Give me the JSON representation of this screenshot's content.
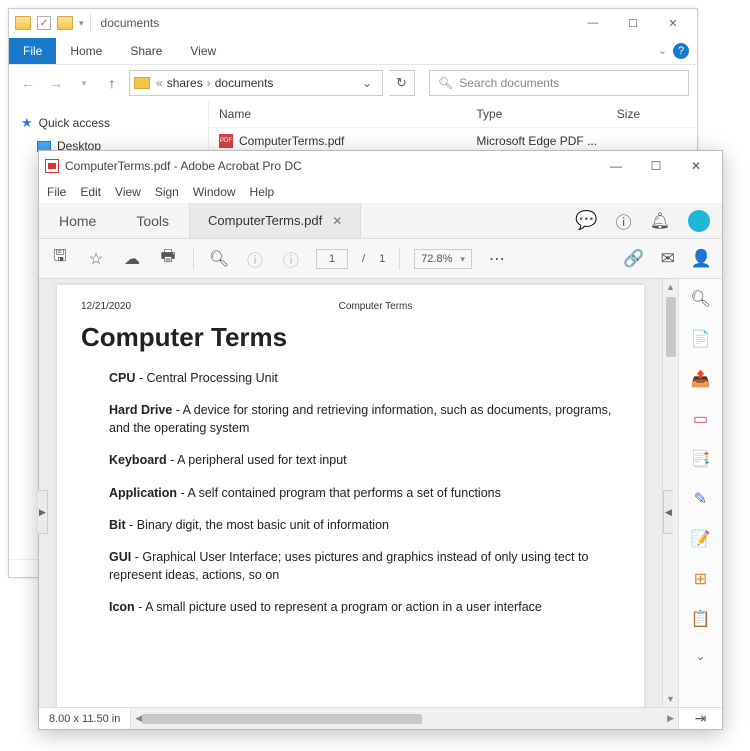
{
  "explorer": {
    "title": "documents",
    "ribbon": {
      "file": "File",
      "home": "Home",
      "share": "Share",
      "view": "View"
    },
    "breadcrumb": {
      "root_hint": "«",
      "items": [
        "shares",
        "documents"
      ]
    },
    "search_placeholder": "Search documents",
    "columns": {
      "name": "Name",
      "type": "Type",
      "size": "Size"
    },
    "tree": {
      "quick_access": "Quick access",
      "desktop": "Desktop"
    },
    "files": [
      {
        "name": "ComputerTerms.pdf",
        "type": "Microsoft Edge PDF ...",
        "size": ""
      }
    ]
  },
  "acrobat": {
    "title": "ComputerTerms.pdf - Adobe Acrobat Pro DC",
    "menu": {
      "file": "File",
      "edit": "Edit",
      "view": "View",
      "sign": "Sign",
      "window": "Window",
      "help": "Help"
    },
    "tabs": {
      "home": "Home",
      "tools": "Tools",
      "doc": "ComputerTerms.pdf"
    },
    "toolbar": {
      "page_current": "1",
      "page_total": "1",
      "page_sep": "/",
      "zoom": "72.8%"
    },
    "status": {
      "dims": "8.00 x 11.50 in"
    },
    "document": {
      "date": "12/21/2020",
      "header_center": "Computer Terms",
      "title": "Computer Terms",
      "terms": [
        {
          "name": "CPU",
          "def": " - Central Processing Unit"
        },
        {
          "name": "Hard Drive",
          "def": " - A device for storing and retrieving information, such as documents, programs, and the operating system"
        },
        {
          "name": "Keyboard",
          "def": " - A peripheral used for text input"
        },
        {
          "name": "Application",
          "def": " - A self contained program that performs a set of functions"
        },
        {
          "name": "Bit",
          "def": " - Binary digit, the most basic unit of information"
        },
        {
          "name": "GUI",
          "def": " - Graphical User Interface; uses pictures and graphics instead of only using tect to represent ideas, actions, so on"
        },
        {
          "name": "Icon",
          "def": " - A small picture used to represent a program or action in a user interface"
        }
      ]
    }
  }
}
